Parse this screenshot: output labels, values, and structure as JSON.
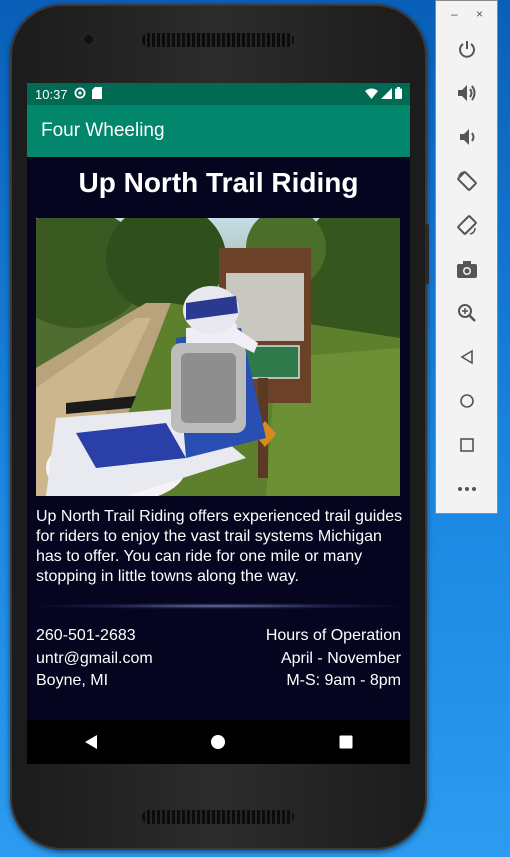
{
  "status_bar": {
    "time": "10:37"
  },
  "app_bar": {
    "title": "Four Wheeling"
  },
  "content": {
    "headline": "Up North Trail Riding",
    "description": "Up North Trail Riding offers experienced trail guides for riders to enjoy the vast trail systems Michigan has to offer.  You can ride for one mile or many stopping in little towns along the way.",
    "contact": {
      "phone": "260-501-2683",
      "email": "untr@gmail.com",
      "location": "Boyne, MI"
    },
    "hours": {
      "title": "Hours of Operation",
      "season": "April - November",
      "days": "M-S: 9am - 8pm"
    }
  },
  "emulator_toolbar": {
    "minimize_label": "–",
    "close_label": "×",
    "buttons": [
      "power",
      "volume-up",
      "volume-down",
      "rotate-left",
      "rotate-right",
      "screenshot",
      "zoom",
      "back",
      "home",
      "overview",
      "more"
    ]
  },
  "colors": {
    "status_bar": "#016a52",
    "app_bar": "#02866c",
    "content_bg": "#05051f",
    "desktop_bg": "#1a86e0"
  }
}
